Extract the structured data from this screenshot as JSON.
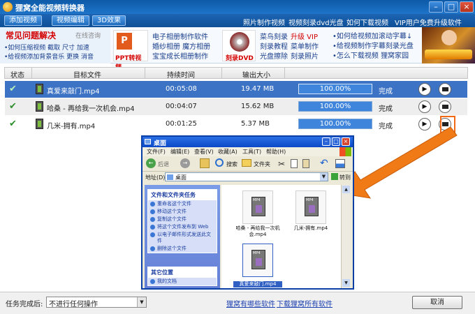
{
  "window": {
    "title": "狸窝全能视频转换器",
    "min": "–",
    "max": "□",
    "close": "×"
  },
  "menubar": {
    "buttons": [
      "添加视频",
      "视频编辑",
      "3D效果"
    ],
    "links": [
      "照片制作视频",
      "视频刻录dvd光盘",
      "如何下载视频",
      "VIP用户免费升级软件"
    ]
  },
  "banner": {
    "faq_title": "常见问题解决",
    "online": "在线咨询",
    "left_lines": [
      "•如何压缩视频 截取 尺寸 加速",
      "•给视频添加背景音乐 更换 消音"
    ],
    "ppt_label": "PPT转视频",
    "mid_links": [
      "电子相册制作软件",
      "婚纱相册  魔方相册",
      "宝宝成长相册制作"
    ],
    "dvd_label": "刻录DVD",
    "dvd_links_row1": [
      "菜鸟刻录",
      "升级 VIP"
    ],
    "dvd_links_row2": [
      "刻录教程",
      "菜单制作"
    ],
    "dvd_links_row3": [
      "光盘擦除",
      "刻录照片"
    ],
    "right_links": [
      "•如何给视频加滚动字幕↓",
      "•给视频制作字幕刻录光盘",
      "•怎么下载视频  狸窝家园"
    ]
  },
  "table": {
    "headers": [
      "状态",
      "目标文件",
      "持续时间",
      "输出大小"
    ],
    "rows": [
      {
        "file": "真爱来敲门.mp4",
        "duration": "00:05:08",
        "size": "19.47 MB",
        "progress": "100.00%",
        "status": "完成"
      },
      {
        "file": "哈桑 - 再给我一次机会.mp4",
        "duration": "00:04:07",
        "size": "15.62 MB",
        "progress": "100.00%",
        "status": "完成"
      },
      {
        "file": "几米-拥有.mp4",
        "duration": "00:01:25",
        "size": "5.37 MB",
        "progress": "100.00%",
        "status": "完成"
      }
    ]
  },
  "explorer": {
    "title": "桌面",
    "menu": [
      "文件(F)",
      "编辑(E)",
      "查看(V)",
      "收藏(A)",
      "工具(T)",
      "帮助(H)"
    ],
    "back": "后退",
    "search": "搜索",
    "folders": "文件夹",
    "address_label": "地址(D)",
    "address": "桌面",
    "go": "转到",
    "task_head": "文件和文件夹任务",
    "tasks": [
      "重命名这个文件",
      "移动这个文件",
      "复制这个文件",
      "将这个文件发布到 Web",
      "以电子邮件形式发送此文件",
      "删除这个文件"
    ],
    "other_head": "其它位置",
    "other": [
      "我的文档"
    ],
    "files": [
      "哈桑 - 再给我一次机会.mp4",
      "几米-拥有.mp4",
      "真爱来敲门.mp4"
    ]
  },
  "bottom": {
    "after_label": "任务完成后:",
    "after_value": "不进行任何操作",
    "link1": "狸窝有哪些软件",
    "link2": "下载狸窝所有软件",
    "cancel": "取消"
  },
  "colors": {
    "accent": "#1f6bbd",
    "selected_row": "#3d73c4",
    "progress": "#3f85dc",
    "arrow": "#f07a16"
  }
}
